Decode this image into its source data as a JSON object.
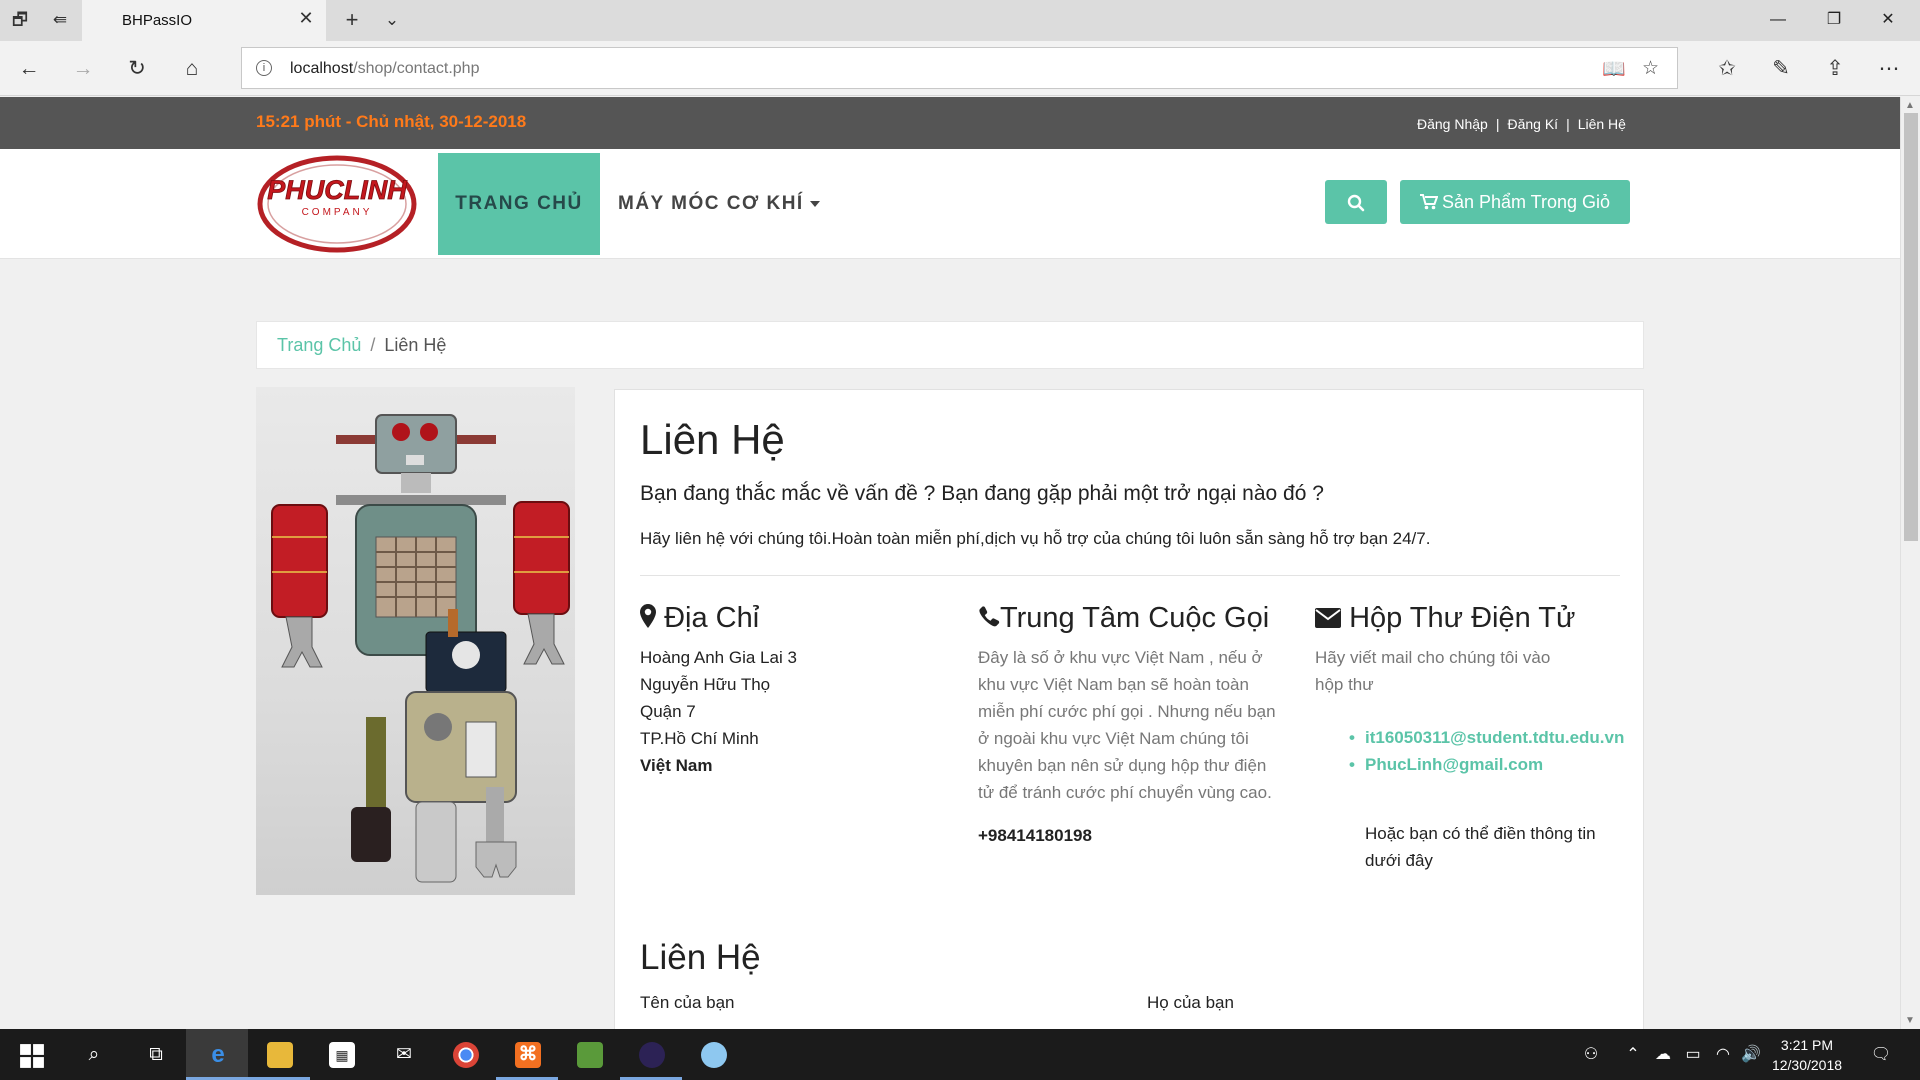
{
  "browser": {
    "tab_title": "BHPassIO",
    "url_host": "localhost",
    "url_path": "/shop/contact.php"
  },
  "topbar": {
    "clock": "15:21 phút - Chủ nhật, 30-12-2018",
    "links": [
      "Đăng Nhập",
      "Đăng Kí",
      "Liên Hệ"
    ],
    "separator": "|"
  },
  "header": {
    "logo_text": "PHUCLINH",
    "logo_sub": "COMPANY",
    "menu": [
      "TRANG CHỦ",
      "MÁY MÓC CƠ KHÍ"
    ],
    "cart_label": "Sản Phẩm Trong Giỏ"
  },
  "breadcrumb": {
    "home": "Trang Chủ",
    "separator": "/",
    "current": "Liên Hệ"
  },
  "contact": {
    "title": "Liên Hệ",
    "lead": "Bạn đang thắc mắc về vấn đề ? Bạn đang gặp phải một trở ngại nào đó ?",
    "desc": "Hãy liên hệ với chúng tôi.Hoàn toàn miễn phí,dịch vụ hỗ trợ của chúng tôi luôn sẵn sàng hỗ trợ bạn 24/7.",
    "address": {
      "heading": "Địa Chỉ",
      "lines": [
        "Hoàng Anh Gia Lai 3",
        "Nguyễn Hữu Thọ",
        "Quận 7",
        "TP.Hồ Chí Minh"
      ],
      "country": "Việt Nam"
    },
    "call": {
      "heading": "Trung Tâm Cuộc Gọi",
      "text": "Đây là số ở khu vực Việt Nam , nếu ở khu vực Việt Nam bạn sẽ hoàn toàn miễn phí cước phí gọi . Nhưng nếu bạn ở ngoài khu vực Việt Nam chúng tôi khuyên bạn nên sử dụng hộp thư điện tử để tránh cước phí chuyển vùng cao.",
      "phone": "+98414180198"
    },
    "mail": {
      "heading": "Hộp Thư Điện Tử",
      "intro": "Hãy viết mail cho chúng tôi vào hộp thư",
      "emails": [
        "it16050311@student.tdtu.edu.vn",
        "PhucLinh@gmail.com"
      ],
      "note": "Hoặc bạn có thể điền thông tin dưới đây"
    },
    "form": {
      "heading": "Liên Hệ",
      "first_name_label": "Tên của bạn",
      "last_name_label": "Họ của bạn"
    }
  },
  "taskbar": {
    "time": "3:21 PM",
    "date": "12/30/2018"
  },
  "colors": {
    "accent": "#5bc4a8",
    "topbar": "#555555",
    "clock": "#ff7a1a"
  }
}
